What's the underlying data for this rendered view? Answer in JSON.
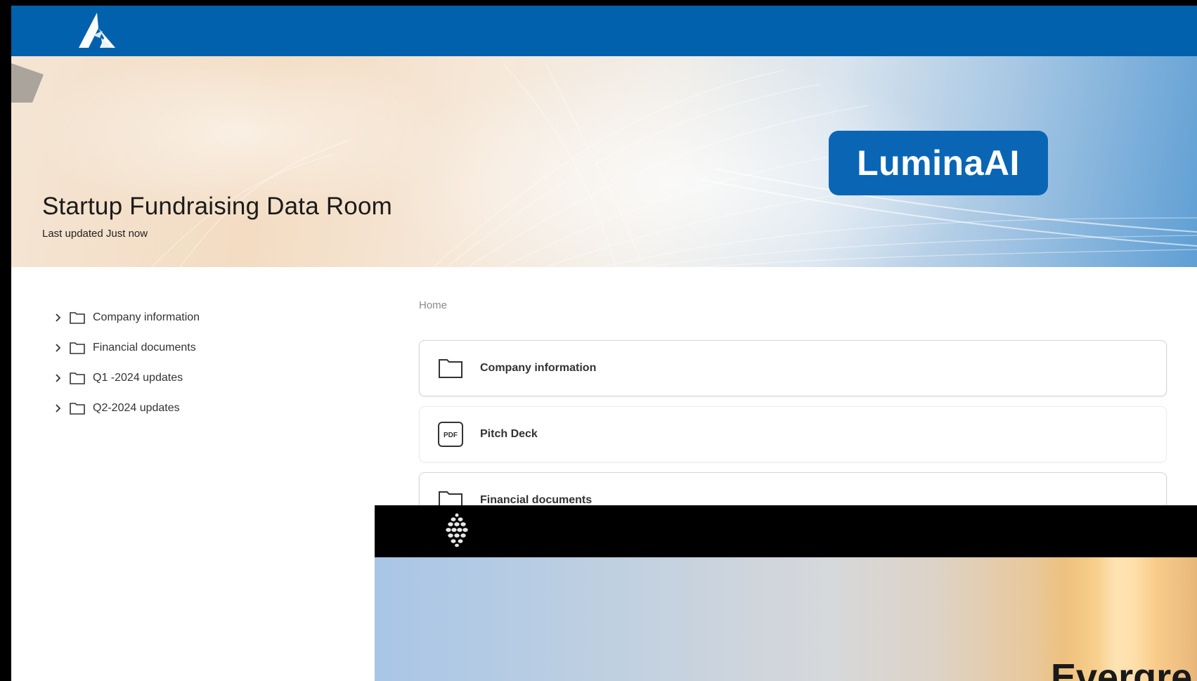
{
  "data_room": {
    "topbar": {
      "logo_icon": "mountain-logo-icon",
      "color": "#0161ac"
    },
    "hero": {
      "brand": "LuminaAI",
      "brand_color": "#0a66b5",
      "title": "Startup Fundraising Data Room",
      "subtitle": "Last updated Just now"
    },
    "tree": {
      "items": [
        {
          "label": "Company information",
          "icon": "folder-icon"
        },
        {
          "label": "Financial documents",
          "icon": "folder-icon"
        },
        {
          "label": "Q1 -2024 updates",
          "icon": "folder-icon"
        },
        {
          "label": "Q2-2024 updates",
          "icon": "folder-icon"
        }
      ]
    },
    "breadcrumb": "Home",
    "items": [
      {
        "label": "Company information",
        "icon": "folder-icon"
      },
      {
        "label": "Pitch Deck",
        "icon": "pdf-file-icon",
        "icon_text": "PDF"
      },
      {
        "label": "Financial documents",
        "icon": "folder-icon"
      }
    ]
  },
  "second_window": {
    "logo_icon": "pinecone-logo-icon",
    "bar_color": "#000000",
    "title": "Evergre"
  }
}
